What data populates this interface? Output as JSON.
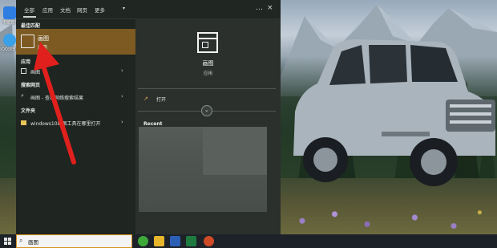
{
  "desktop": {
    "icons": [
      {
        "name": "电脑管家",
        "icon": "shield-icon",
        "color": "#2e7de0"
      },
      {
        "name": "QQ浏览器",
        "icon": "qq-browser-icon",
        "color": "#3aa0e8"
      }
    ]
  },
  "start_menu": {
    "tabs": [
      {
        "label": "全部",
        "active": true
      },
      {
        "label": "应用",
        "active": false
      },
      {
        "label": "文档",
        "active": false
      },
      {
        "label": "网页",
        "active": false
      },
      {
        "label": "更多",
        "active": false
      }
    ],
    "more_dots": "…",
    "close": "×",
    "best_match": {
      "heading": "最佳匹配",
      "title": "画图",
      "subtitle": "应用"
    },
    "apps": {
      "heading": "应用",
      "items": [
        {
          "label": "画图",
          "arrow": "›"
        }
      ]
    },
    "web_search": {
      "heading": "搜索网页",
      "items": [
        {
          "label": "画图 - 查看网络搜索结果",
          "arrow": "›"
        }
      ]
    },
    "folders": {
      "heading": "文件夹",
      "items": [
        {
          "label": "windows10画图工具在哪里打开",
          "arrow": "›"
        }
      ]
    },
    "detail": {
      "app_name": "画图",
      "app_type": "应用",
      "open_label": "打开",
      "expand_glyph": "⌄",
      "recent_heading": "Recent"
    }
  },
  "search_box": {
    "value": "画图",
    "icon": "search-icon"
  },
  "taskbar": {
    "start_icon": "windows-start-icon",
    "apps": [
      {
        "name": "360-browser-icon",
        "color": "#3ea83a"
      },
      {
        "name": "file-explorer-icon",
        "color": "#e8b62c"
      },
      {
        "name": "word-icon",
        "color": "#2b5fb5"
      },
      {
        "name": "excel-icon",
        "color": "#1f7a40"
      },
      {
        "name": "powerpoint-icon",
        "color": "#d04a26"
      }
    ]
  },
  "colors": {
    "accent_highlight": "#7c5a22",
    "search_border": "#d7901f",
    "annotation_arrow": "#e0201c"
  }
}
